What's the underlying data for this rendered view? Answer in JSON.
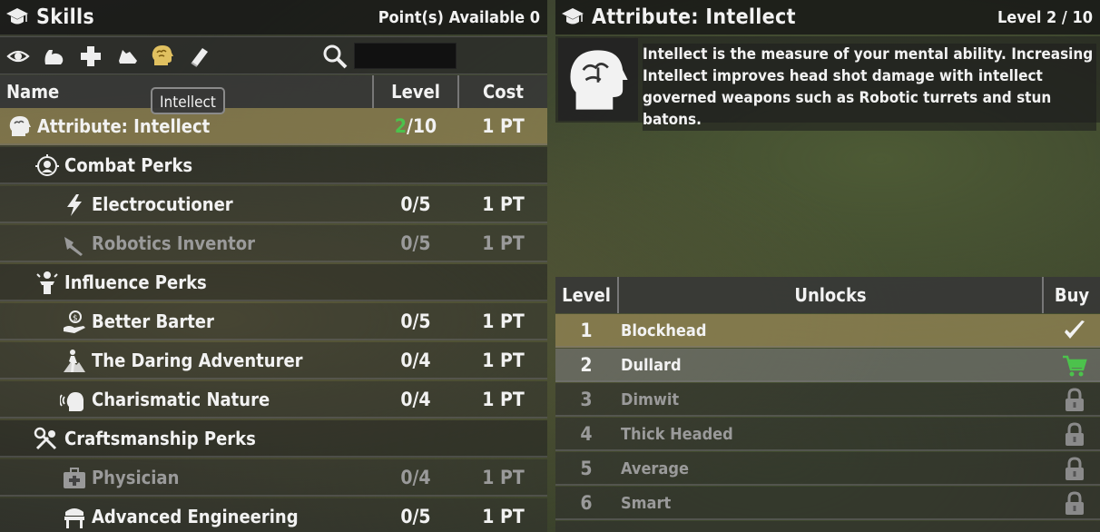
{
  "skills_panel": {
    "title": "Skills",
    "points_available": "Point(s) Available 0",
    "toolbar_icons": [
      "eye-icon",
      "strength-arm-icon",
      "plus-icon",
      "running-shoe-icon",
      "brain-head-icon",
      "book-icon"
    ],
    "search_placeholder": "",
    "columns": {
      "name": "Name",
      "level": "Level",
      "cost": "Cost"
    },
    "tooltip": "Intellect",
    "rows": [
      {
        "type": "attr",
        "icon": "brain-head-icon",
        "name": "Attribute: Intellect",
        "level_current": "2",
        "level_max": "/10",
        "cost": "1 PT"
      },
      {
        "type": "cat",
        "icon": "combat-target-icon",
        "name": "Combat Perks"
      },
      {
        "type": "perk",
        "icon": "lightning-icon",
        "name": "Electrocutioner",
        "level": "0/5",
        "cost": "1 PT"
      },
      {
        "type": "perk",
        "icon": "robot-arm-icon",
        "name": "Robotics Inventor",
        "level": "0/5",
        "cost": "1 PT",
        "dim": true
      },
      {
        "type": "cat",
        "icon": "podium-speaker-icon",
        "name": "Influence Perks"
      },
      {
        "type": "perk",
        "icon": "handshake-coin-icon",
        "name": "Better Barter",
        "level": "0/5",
        "cost": "1 PT"
      },
      {
        "type": "perk",
        "icon": "adventurer-icon",
        "name": "The Daring Adventurer",
        "level": "0/4",
        "cost": "1 PT"
      },
      {
        "type": "perk",
        "icon": "speaking-head-icon",
        "name": "Charismatic Nature",
        "level": "0/4",
        "cost": "1 PT"
      },
      {
        "type": "cat",
        "icon": "tools-icon",
        "name": "Craftsmanship Perks"
      },
      {
        "type": "perk",
        "icon": "medkit-icon",
        "name": "Physician",
        "level": "0/4",
        "cost": "1 PT",
        "dim": true
      },
      {
        "type": "perk",
        "icon": "workbench-icon",
        "name": "Advanced Engineering",
        "level": "0/5",
        "cost": "1 PT"
      }
    ]
  },
  "detail_panel": {
    "title": "Attribute: Intellect",
    "level_text": "Level 2 / 10",
    "description": "Intellect is the measure of your mental ability. Increasing Intellect improves head shot damage with intellect governed weapons such as Robotic turrets and stun batons.",
    "columns": {
      "level": "Level",
      "unlocks": "Unlocks",
      "buy": "Buy"
    },
    "unlocks": [
      {
        "level": "1",
        "name": "Blockhead",
        "state": "owned",
        "icon": "checkmark-icon"
      },
      {
        "level": "2",
        "name": "Dullard",
        "state": "next",
        "icon": "shopping-cart-icon"
      },
      {
        "level": "3",
        "name": "Dimwit",
        "state": "locked",
        "icon": "lock-icon"
      },
      {
        "level": "4",
        "name": "Thick Headed",
        "state": "locked",
        "icon": "lock-icon"
      },
      {
        "level": "5",
        "name": "Average",
        "state": "locked",
        "icon": "lock-icon"
      },
      {
        "level": "6",
        "name": "Smart",
        "state": "locked",
        "icon": "lock-icon"
      }
    ]
  },
  "colors": {
    "accent_green": "#4cc24c",
    "selected_row": "#968755",
    "text": "#f2f2f2"
  }
}
